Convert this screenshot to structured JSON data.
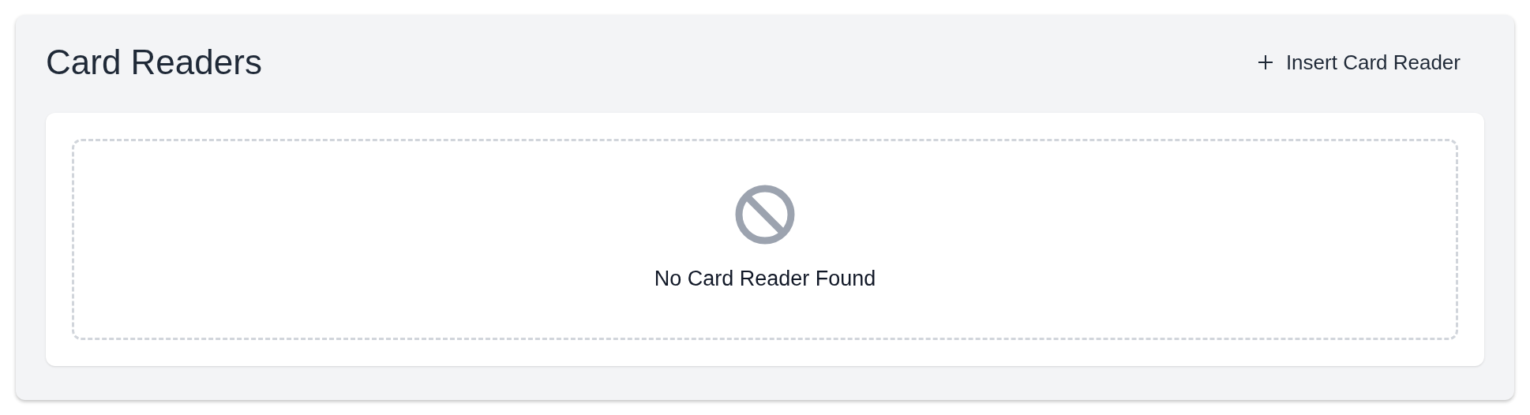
{
  "title": "Card Readers",
  "action_button": {
    "label": "Insert Card Reader"
  },
  "empty_state": {
    "message": "No Card Reader Found"
  }
}
